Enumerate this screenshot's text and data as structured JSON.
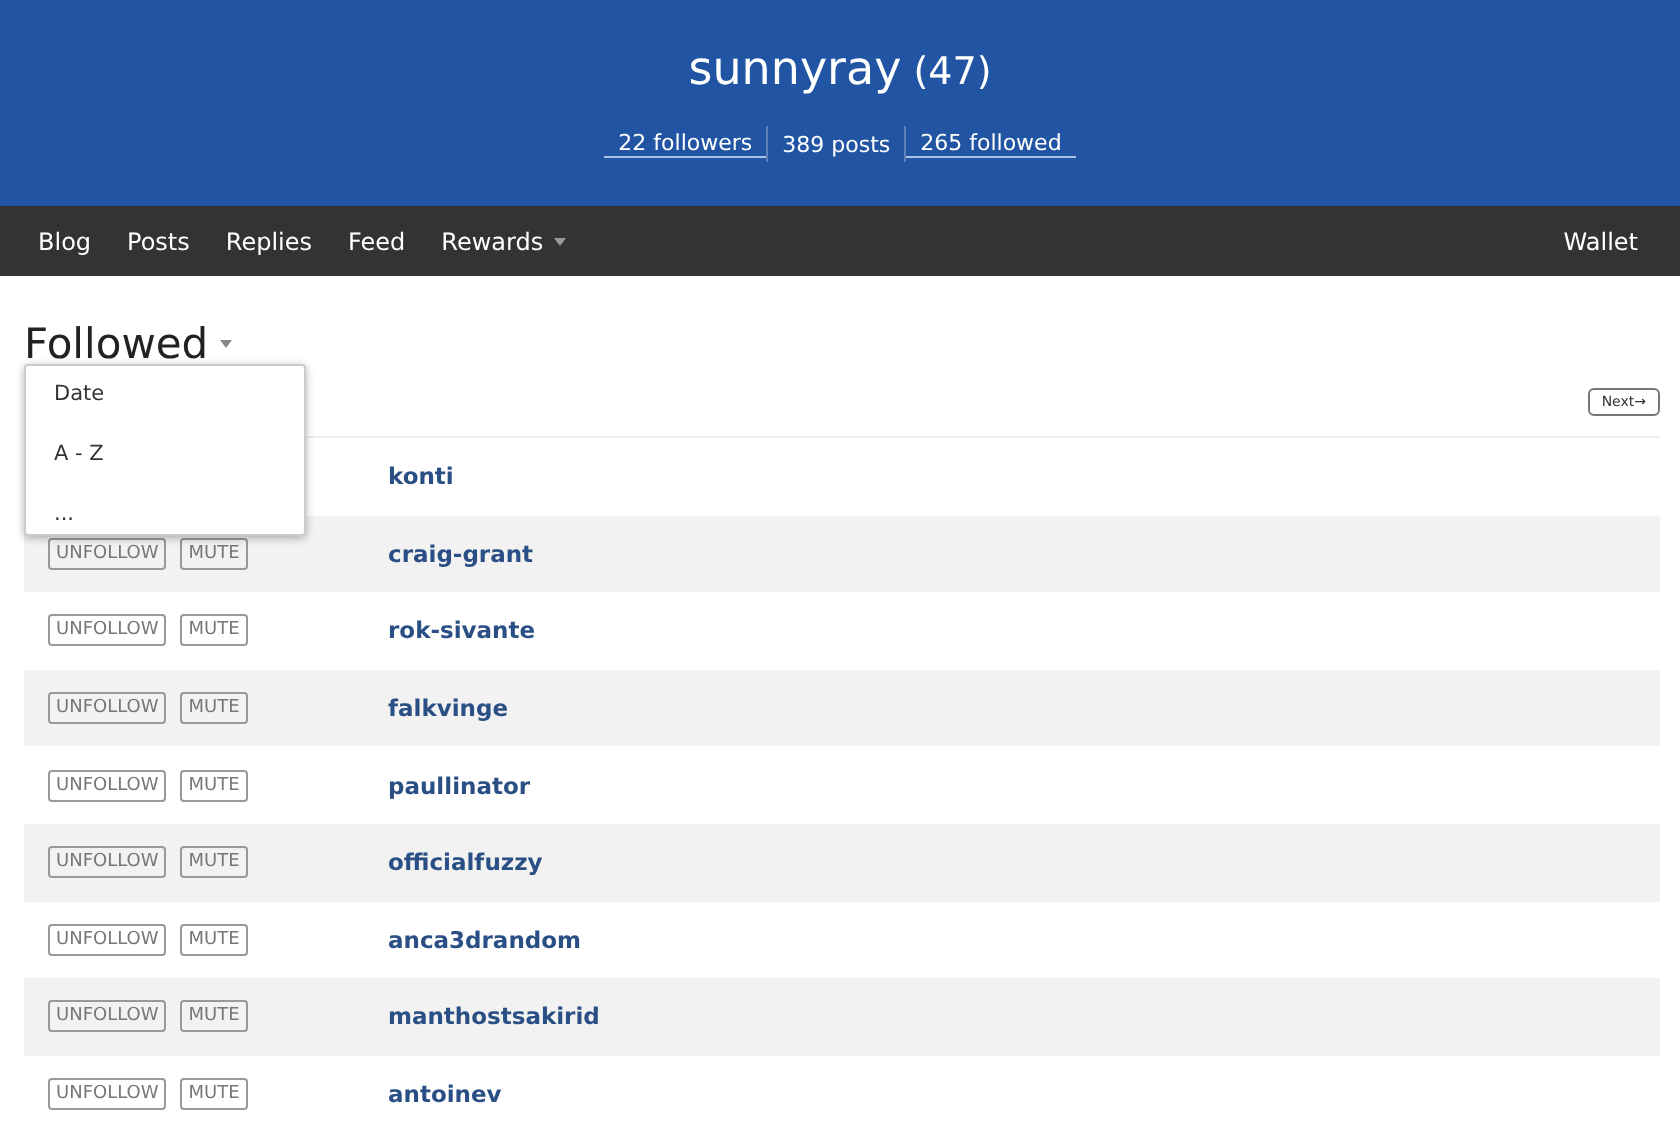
{
  "profile": {
    "name": "sunnyray",
    "reputation": "(47)",
    "stats": [
      {
        "label": "22 followers",
        "link": true
      },
      {
        "label": "389 posts",
        "link": false
      },
      {
        "label": "265 followed",
        "link": true
      }
    ]
  },
  "nav": {
    "items": [
      {
        "label": "Blog",
        "caret": false
      },
      {
        "label": "Posts",
        "caret": false
      },
      {
        "label": "Replies",
        "caret": false
      },
      {
        "label": "Feed",
        "caret": false
      },
      {
        "label": "Rewards",
        "caret": true
      }
    ],
    "right": "Wallet"
  },
  "heading": "Followed",
  "sort_menu": {
    "expanded": true,
    "items": [
      "Date",
      "A - Z",
      "..."
    ]
  },
  "pager": {
    "next": "Next→"
  },
  "rows": [
    {
      "name": "konti",
      "actions": []
    },
    {
      "name": "craig-grant",
      "actions": [
        "UNFOLLOW",
        "MUTE"
      ]
    },
    {
      "name": "rok-sivante",
      "actions": [
        "UNFOLLOW",
        "MUTE"
      ]
    },
    {
      "name": "falkvinge",
      "actions": [
        "UNFOLLOW",
        "MUTE"
      ]
    },
    {
      "name": "paullinator",
      "actions": [
        "UNFOLLOW",
        "MUTE"
      ]
    },
    {
      "name": "officialfuzzy",
      "actions": [
        "UNFOLLOW",
        "MUTE"
      ]
    },
    {
      "name": "anca3drandom",
      "actions": [
        "UNFOLLOW",
        "MUTE"
      ]
    },
    {
      "name": "manthostsakirid",
      "actions": [
        "UNFOLLOW",
        "MUTE"
      ]
    },
    {
      "name": "antoinev",
      "actions": [
        "UNFOLLOW",
        "MUTE"
      ]
    }
  ]
}
